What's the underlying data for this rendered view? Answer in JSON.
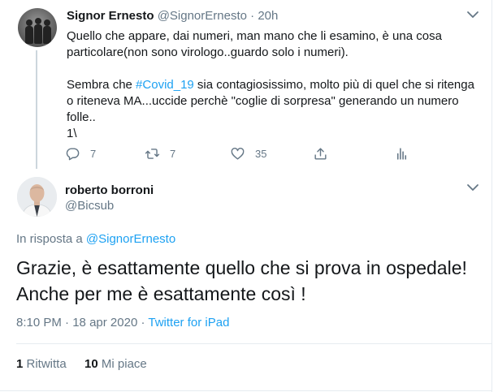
{
  "parent_tweet": {
    "name": "Signor Ernesto",
    "handle": "@SignorErnesto",
    "separator": "·",
    "time": "20h",
    "text": {
      "line1": "Quello che appare, dai numeri, man mano che li esamino, è una cosa",
      "line2": "particolare(non sono virologo..guardo solo i numeri).",
      "line3_pre": "Sembra che ",
      "line3_hashtag": "#Covid_19",
      "line3_post": " sia contagiosissimo, molto più di quel che si ritenga",
      "line4": "o riteneva MA...uccide perchè \"coglie di sorpresa\" generando un numero",
      "line5": "folle..",
      "line6": "1\\"
    },
    "actions": {
      "reply_count": "7",
      "retweet_count": "7",
      "like_count": "35"
    }
  },
  "main_tweet": {
    "name": "roberto borroni",
    "handle": "@Bicsub",
    "reply_prefix": "In risposta a ",
    "reply_handle": "@SignorErnesto",
    "text_line1": "Grazie, è esattamente quello che si prova in ospedale!",
    "text_line2": "Anche per me è esattamente così !",
    "time": "8:10 PM",
    "date": "18 apr 2020",
    "separator": "·",
    "source": "Twitter for iPad",
    "retweets_count": "1",
    "retweets_label": "Ritwitta",
    "likes_count": "10",
    "likes_label": "Mi piace"
  },
  "colors": {
    "link": "#1da1f2",
    "secondary_text": "#657786",
    "primary_text": "#14171a",
    "divider": "#e6ecf0"
  },
  "icons": [
    "chevron-down-icon",
    "reply-icon",
    "retweet-icon",
    "like-icon",
    "share-icon",
    "analytics-icon"
  ]
}
